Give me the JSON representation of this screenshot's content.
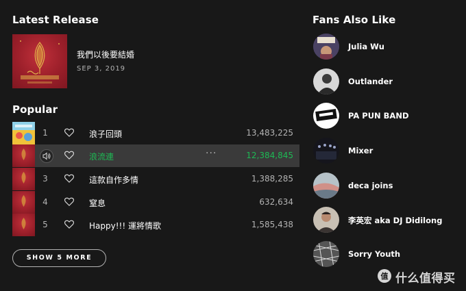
{
  "latest_release": {
    "section_title": "Latest Release",
    "title": "我們以後要結婚",
    "date": "SEP 3, 2019"
  },
  "popular": {
    "section_title": "Popular",
    "tracks": [
      {
        "num": "1",
        "title": "浪子回頭",
        "plays": "13,483,225",
        "active": false
      },
      {
        "num": "2",
        "title": "浪流連",
        "plays": "12,384,845",
        "active": true
      },
      {
        "num": "3",
        "title": "這款自作多情",
        "plays": "1,388,285",
        "active": false
      },
      {
        "num": "4",
        "title": "窒息",
        "plays": "632,634",
        "active": false
      },
      {
        "num": "5",
        "title": "Happy!!! 運將情歌",
        "plays": "1,585,438",
        "active": false
      }
    ],
    "more_label": "···",
    "show_more_label": "SHOW 5 MORE"
  },
  "fans_also_like": {
    "section_title": "Fans Also Like",
    "artists": [
      {
        "name": "Julia Wu"
      },
      {
        "name": "Outlander"
      },
      {
        "name": "PA PUN BAND"
      },
      {
        "name": "Mixer"
      },
      {
        "name": "deca joins"
      },
      {
        "name": "李英宏 aka DJ Didilong"
      },
      {
        "name": "Sorry Youth"
      }
    ]
  },
  "watermark": {
    "text": "什么值得买"
  },
  "colors": {
    "background": "#181818",
    "accent_green": "#1db954",
    "row_highlight": "#3a3a3a",
    "muted_text": "#b3b3b3"
  }
}
